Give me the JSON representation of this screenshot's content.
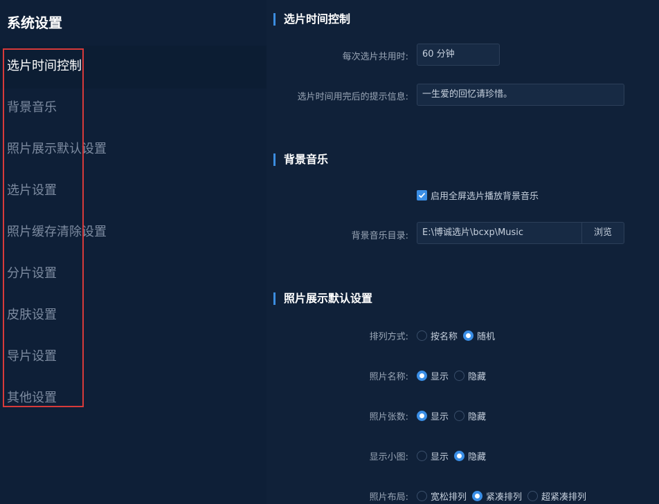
{
  "sidebar": {
    "title": "系统设置",
    "items": [
      {
        "label": "选片时间控制"
      },
      {
        "label": "背景音乐"
      },
      {
        "label": "照片展示默认设置"
      },
      {
        "label": "选片设置"
      },
      {
        "label": "照片缓存清除设置"
      },
      {
        "label": "分片设置"
      },
      {
        "label": "皮肤设置"
      },
      {
        "label": "导片设置"
      },
      {
        "label": "其他设置"
      }
    ]
  },
  "time_control": {
    "title": "选片时间控制",
    "total_time_label": "每次选片共用时:",
    "total_time_value": "60 分钟",
    "message_label": "选片时间用完后的提示信息:",
    "message_value": "一生爱的回忆请珍惜。"
  },
  "music": {
    "title": "背景音乐",
    "fullscreen_label": "启用全屏选片播放背景音乐",
    "fullscreen_checked": true,
    "dir_label": "背景音乐目录:",
    "dir_value": "E:\\博诚选片\\bcxp\\Music",
    "browse_label": "浏览"
  },
  "display": {
    "title": "照片展示默认设置",
    "sort_label": "排列方式:",
    "sort_options": [
      "按名称",
      "随机"
    ],
    "sort_selected": "随机",
    "name_label": "照片名称:",
    "name_options": [
      "显示",
      "隐藏"
    ],
    "name_selected": "显示",
    "count_label": "照片张数:",
    "count_options": [
      "显示",
      "隐藏"
    ],
    "count_selected": "显示",
    "thumb_label": "显示小图:",
    "thumb_options": [
      "显示",
      "隐藏"
    ],
    "thumb_selected": "隐藏",
    "layout_label": "照片布局:",
    "layout_options": [
      "宽松排列",
      "紧凑排列",
      "超紧凑排列"
    ],
    "layout_selected": "紧凑排列"
  },
  "colors": {
    "background": "#0f2038",
    "accent": "#3a8ee6",
    "highlight_box": "#d83a3a"
  }
}
